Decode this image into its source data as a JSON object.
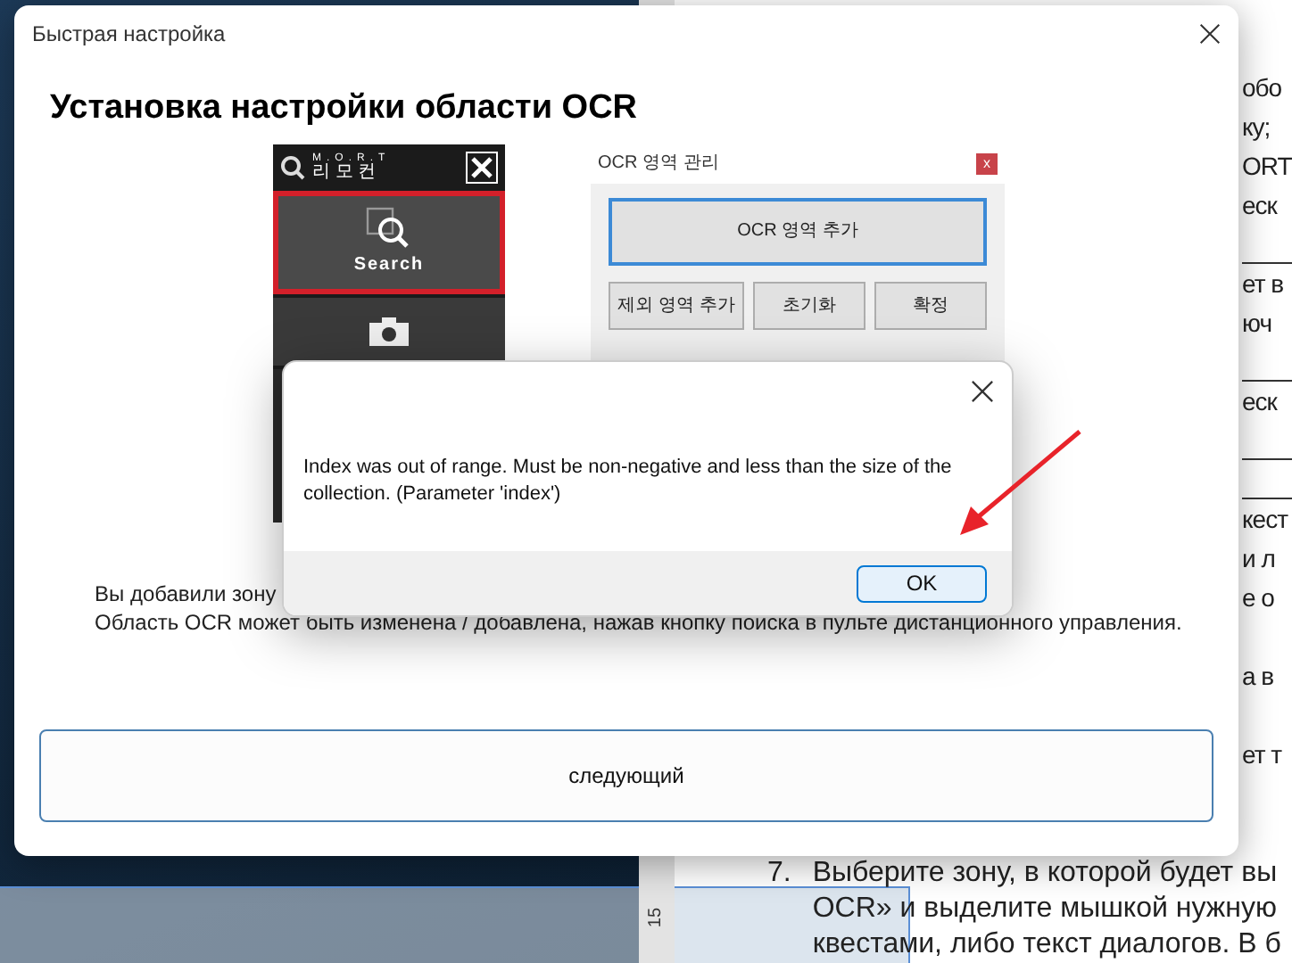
{
  "background_document": {
    "ruler_label": "15",
    "fragments": [
      {
        "kind": "text",
        "text": "обо"
      },
      {
        "kind": "text",
        "text": "ку;"
      },
      {
        "kind": "text",
        "text": "ORT"
      },
      {
        "kind": "text",
        "text": "еск"
      },
      {
        "kind": "rule"
      },
      {
        "kind": "text",
        "text": "ет в"
      },
      {
        "kind": "text",
        "text": "юч"
      },
      {
        "kind": "rule"
      },
      {
        "kind": "text",
        "text": "еск"
      },
      {
        "kind": "rule"
      },
      {
        "kind": "rule"
      },
      {
        "kind": "text",
        "text": "кест"
      },
      {
        "kind": "text",
        "text": "и л"
      },
      {
        "kind": "text",
        "text": "е о"
      },
      {
        "kind": "gap"
      },
      {
        "kind": "text",
        "text": "а в"
      },
      {
        "kind": "gap"
      },
      {
        "kind": "text",
        "text": "ет т"
      }
    ],
    "list_item": {
      "number": "7.",
      "lines": [
        "Выберите зону, в которой будет вы",
        "OCR» и выделите мышкой нужную",
        "квестами, либо текст диалогов. В б"
      ]
    }
  },
  "main_window": {
    "title": "Быстрая настройка",
    "heading": "Установка настройки области OCR",
    "remote_panel": {
      "logo_top": "M.O.R.T",
      "logo_bottom": "리 모 컨",
      "search_label": "Search",
      "search_highlighted": true
    },
    "ocr_window": {
      "title": "OCR 영역 관리",
      "close": "x",
      "main_button": "OCR 영역 추가",
      "buttons": [
        "제외 영역 추가",
        "초기화",
        "확정"
      ]
    },
    "description": [
      "Вы добавили зону",
      "Область OCR может быть изменена / добавлена, нажав кнопку поиска в пульте дистанционного управления."
    ],
    "next_button": "следующий"
  },
  "error_dialog": {
    "message": "Index was out of range. Must be non-negative and less than the size of the collection. (Parameter 'index')",
    "ok_button": "OK"
  }
}
